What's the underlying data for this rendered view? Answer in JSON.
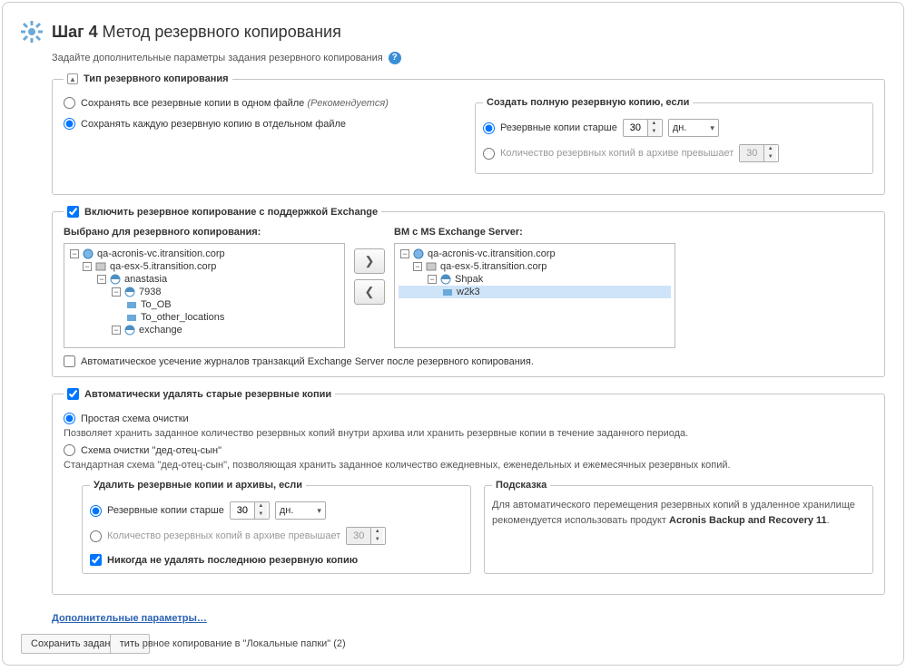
{
  "title": {
    "step": "Шаг 4",
    "rest": "Метод резервного копирования"
  },
  "subtitle": "Задайте дополнительные параметры задания резервного копирования",
  "backup_type": {
    "legend": "Тип резервного копирования",
    "opt_single": "Сохранять все резервные копии в одном файле",
    "opt_single_hint": "(Рекомендуется)",
    "opt_separate": "Сохранять каждую резервную копию в отдельном файле",
    "full_copy": {
      "legend": "Создать полную резервную копию, если",
      "older_label": "Резервные копии старше",
      "older_value": "30",
      "older_unit": "дн.",
      "count_label": "Количество резервных копий в архиве превышает",
      "count_value": "30"
    }
  },
  "exchange": {
    "legend": "Включить резервное копирование с поддержкой Exchange",
    "left_heading": "Выбрано для резервного копирования:",
    "right_heading": "ВМ с MS Exchange Server:",
    "left_tree": {
      "n0": "qa-acronis-vc.itransition.corp",
      "n1": "qa-esx-5.itransition.corp",
      "n2": "anastasia",
      "n3": "7938",
      "n4": "To_OB",
      "n5": "To_other_locations",
      "n6": "exchange"
    },
    "right_tree": {
      "n0": "qa-acronis-vc.itransition.corp",
      "n1": "qa-esx-5.itransition.corp",
      "n2": "Shpak",
      "n3": "w2k3"
    },
    "auto_trunc": "Автоматическое усечение журналов транзакций Exchange Server после резервного копирования."
  },
  "auto_delete": {
    "legend": "Автоматически удалять старые резервные копии",
    "simple_label": "Простая схема очистки",
    "simple_desc": "Позволяет хранить заданное количество резервных копий внутри архива или хранить резервные копии в течение заданного периода.",
    "gfs_label": "Схема очистки \"дед-отец-сын\"",
    "gfs_desc": "Стандартная схема \"дед-отец-сын\", позволяющая хранить заданное количество ежедневных, еженедельных и ежемесячных резервных копий.",
    "delete_if": {
      "legend": "Удалить резервные копии и архивы, если",
      "older_label": "Резервные копии старше",
      "older_value": "30",
      "older_unit": "дн.",
      "count_label": "Количество резервных копий в архиве превышает",
      "count_value": "30",
      "never_last": "Никогда не удалять последнюю резервную копию"
    },
    "hint": {
      "legend": "Подсказка",
      "text_1": "Для автоматического перемещения резервных копий в удаленное хранилище рекомендуется использовать продукт",
      "product": "Acronis Backup and Recovery 11"
    }
  },
  "more_params": "Дополнительные параметры…",
  "footer": {
    "btn1": "Сохранить задание",
    "btn2_visible": "тить",
    "tail": "  рвное копирование в \"Локальные папки\" (2)"
  }
}
